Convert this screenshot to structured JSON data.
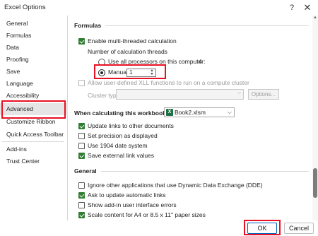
{
  "window": {
    "title": "Excel Options",
    "help_glyph": "?",
    "close_glyph": "✕"
  },
  "sidebar": {
    "items": [
      {
        "label": "General"
      },
      {
        "label": "Formulas"
      },
      {
        "label": "Data"
      },
      {
        "label": "Proofing"
      },
      {
        "label": "Save"
      },
      {
        "label": "Language"
      },
      {
        "label": "Accessibility"
      },
      {
        "label": "Advanced"
      },
      {
        "label": "Customize Ribbon"
      },
      {
        "label": "Quick Access Toolbar"
      },
      {
        "label": "Add-ins"
      },
      {
        "label": "Trust Center"
      }
    ],
    "selected": "Advanced"
  },
  "formulas": {
    "heading": "Formulas",
    "multithread_label": "Enable multi-threaded calculation",
    "threads_label": "Number of calculation threads",
    "use_all_label": "Use all processors on this computer:",
    "processor_count": "4",
    "manual_label": "Manual",
    "manual_value": "1",
    "xll_label": "Allow user-defined XLL functions to run on a compute cluster",
    "cluster_type_label": "Cluster type:",
    "options_button": "Options..."
  },
  "workbook": {
    "label": "When calculating this workbook:",
    "selected": "Book2.xlsm",
    "items": [
      {
        "label": "Update links to other documents",
        "checked": true
      },
      {
        "label": "Set precision as displayed",
        "checked": false
      },
      {
        "label": "Use 1904 date system",
        "checked": false
      },
      {
        "label": "Save external link values",
        "checked": true
      }
    ]
  },
  "general": {
    "heading": "General",
    "items": [
      {
        "label": "Ignore other applications that use Dynamic Data Exchange (DDE)",
        "checked": false
      },
      {
        "label": "Ask to update automatic links",
        "checked": true
      },
      {
        "label": "Show add-in user interface errors",
        "checked": false
      },
      {
        "label": "Scale content for A4 or 8.5 x 11\" paper sizes",
        "checked": true
      }
    ]
  },
  "footer": {
    "ok": "OK",
    "cancel": "Cancel"
  },
  "colors": {
    "highlight": "#e81123",
    "checkbox": "#2f7d32",
    "selected_bg": "#e5e5e5"
  }
}
